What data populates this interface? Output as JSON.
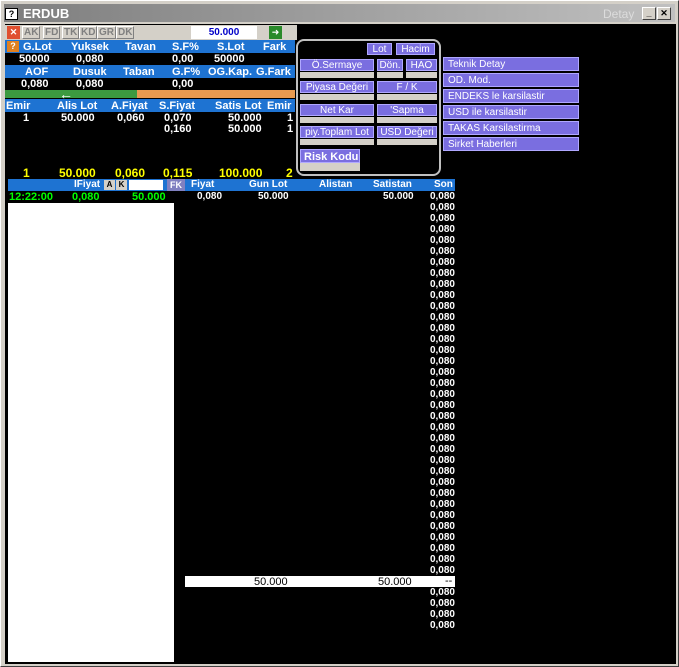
{
  "window": {
    "title": "ERDUB",
    "title_right": "Detay",
    "sys_icon": "?"
  },
  "toolbar": {
    "close_icon": "✕",
    "buttons": [
      "AK",
      "FD",
      "TK",
      "KD",
      "GR",
      "DK"
    ],
    "price_input": "50.000",
    "go_icon": "➜"
  },
  "row1": {
    "help_icon": "?",
    "headers": [
      "G.Lot",
      "Yuksek",
      "Tavan",
      "S.F%",
      "S.Lot",
      "Fark"
    ],
    "values": [
      "50000",
      "0,080",
      "",
      "0,00",
      "50000",
      ""
    ]
  },
  "row2": {
    "headers": [
      "AOF",
      "Dusuk",
      "Taban",
      "G.F%",
      "OG.Kap.",
      "G.Fark"
    ],
    "values": [
      "0,080",
      "0,080",
      "",
      "0,00"
    ],
    "arrow_icon": "←"
  },
  "orders": {
    "headers": [
      "Emir",
      "Alis Lot",
      "A.Fiyat",
      "S.Fiyat",
      "Satis Lot",
      "Emir"
    ],
    "rows": [
      [
        "1",
        "50.000",
        "0,060",
        "0,070",
        "50.000",
        "1"
      ],
      [
        "",
        "",
        "",
        "0,160",
        "50.000",
        "1"
      ]
    ],
    "totals": [
      "1",
      "50.000",
      "0,060",
      "0,115",
      "100.000",
      "2"
    ]
  },
  "trades_panel": {
    "header": "IFiyat",
    "btn_a": "A",
    "btn_k": "K",
    "btn_fk": "FK",
    "row": {
      "time": "12:22:00",
      "price": "0,080",
      "lot": "50.000"
    }
  },
  "depth": {
    "headers": [
      "Fiyat",
      "Gun Lot",
      "Alistan",
      "Satistan",
      "Son"
    ],
    "row": {
      "fiyat": "0,080",
      "gun_lot": "50.000",
      "satistan": "50.000"
    },
    "son_values": [
      "0,080",
      "0,080",
      "0,080",
      "0,080",
      "0,080",
      "0,080",
      "0,080",
      "0,080",
      "0,080",
      "0,080",
      "0,080",
      "0,080",
      "0,080",
      "0,080",
      "0,080",
      "0,080",
      "0,080",
      "0,080",
      "0,080",
      "0,080",
      "0,080",
      "0,080",
      "0,080",
      "0,080",
      "0,080",
      "0,080",
      "0,080",
      "0,080",
      "0,080",
      "0,080",
      "0,080",
      "0,080",
      "0,080",
      "0,080",
      "0,080",
      "0,080",
      "0,080",
      "0,080",
      "0,080",
      "0,080"
    ],
    "footer": {
      "gun_lot": "50.000",
      "satistan": "50.000",
      "son": "--"
    }
  },
  "popup": {
    "lot": "Lot",
    "hacim": "Hacim",
    "o_sermaye": "Ö.Sermaye",
    "don": "Dön.",
    "hao": "HAO",
    "piyasa_degeri": "Piyasa Değeri",
    "fk": "F / K",
    "net_kar": "Net Kar",
    "sapma": "'Sapma",
    "piy_toplam_lot": "piy.Toplam Lot",
    "usd_degeri": "USD Değeri",
    "risk_kodu": "Risk Kodu"
  },
  "menu": [
    "Teknik Detay",
    "OD. Mod.",
    "ENDEKS le karsilastir",
    "USD ile karsilastir",
    "TAKAS Karsilastirma",
    "Sirket Haberleri"
  ],
  "colors": {
    "header_blue": "#1e73d2",
    "popup_purple": "#7a6ee0",
    "yellow": "#ffff00",
    "green": "#00ff00"
  }
}
